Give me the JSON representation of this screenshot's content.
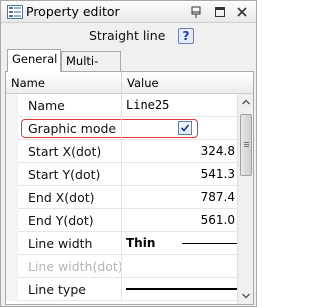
{
  "window": {
    "title": "Property editor",
    "subtitle": "Straight line",
    "help_label": "?"
  },
  "tabs": [
    {
      "label": "General",
      "active": true
    },
    {
      "label": "Multi-page",
      "active": false
    }
  ],
  "grid": {
    "headers": {
      "name": "Name",
      "value": "Value"
    },
    "rows": [
      {
        "name": "Name",
        "value": "Line25"
      },
      {
        "name": "Graphic mode",
        "checked": true
      },
      {
        "name": "Start X(dot)",
        "value": "324.8"
      },
      {
        "name": "Start Y(dot)",
        "value": "541.3"
      },
      {
        "name": "End X(dot)",
        "value": "787.4"
      },
      {
        "name": "End Y(dot)",
        "value": "561.0"
      },
      {
        "name": "Line width",
        "value": "Thin"
      },
      {
        "name": "Line width(dot)",
        "value": "",
        "disabled": true
      },
      {
        "name": "Line type",
        "value": ""
      }
    ]
  },
  "colors": {
    "highlight": "#e0383b",
    "checkbox_border": "#5e7eb0",
    "help_icon": "#1a3ea7"
  }
}
